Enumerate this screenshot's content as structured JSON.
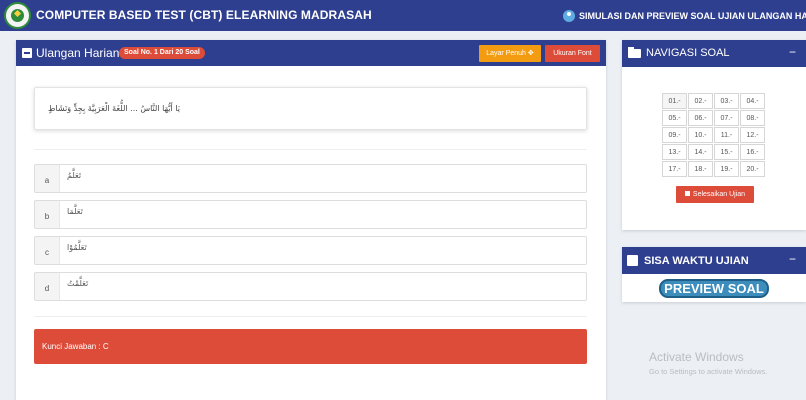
{
  "header": {
    "title": "COMPUTER BASED TEST (CBT) ELEARNING MADRASAH",
    "user_text": "SIMULASI DAN PREVIEW SOAL UJIAN ULANGAN HARIAN",
    "logo_icon": "madrasah-logo",
    "user_icon": "user-circle-icon",
    "bg_color": "#2f3f8f"
  },
  "question_panel": {
    "title": "Ulangan Harian",
    "badge": "Soal No. 1 Dari 20 Soal",
    "fullscreen_button": "Layar Penuh ✥",
    "font_button": "Ukuran Font",
    "question_text": "يَا أَيُّهَا النَّاسُ ... اللُّغَةَ الْعَرَبِيَّةَ بِجِدٍّ وَنَشَاطٍ",
    "options": [
      {
        "letter": "a",
        "text": "تَعَلَّمُ"
      },
      {
        "letter": "b",
        "text": "تَعَلَّمَا"
      },
      {
        "letter": "c",
        "text": "تَعَلَّمُوْا"
      },
      {
        "letter": "d",
        "text": "تَعَلَّمْتُ"
      }
    ],
    "answer_key": "Kunci Jawaban : C",
    "answer_color": "#dd4b39"
  },
  "navigation": {
    "title": "NAVIGASI SOAL",
    "collapse_label": "−",
    "numbers": [
      "01.-",
      "02.-",
      "03.-",
      "04.-",
      "05.-",
      "06.-",
      "07.-",
      "08.-",
      "09.-",
      "10.-",
      "11.-",
      "12.-",
      "13.-",
      "14.-",
      "15.-",
      "16.-",
      "17.-",
      "18.-",
      "19.-",
      "20.-"
    ],
    "finish_button": "Selesaikan Ujian"
  },
  "timer": {
    "title": "SISA WAKTU UJIAN",
    "collapse_label": "−",
    "preview_badge": "PREVIEW SOAL"
  },
  "watermark": {
    "title": "Activate Windows",
    "subtitle": "Go to Settings to activate Windows."
  }
}
